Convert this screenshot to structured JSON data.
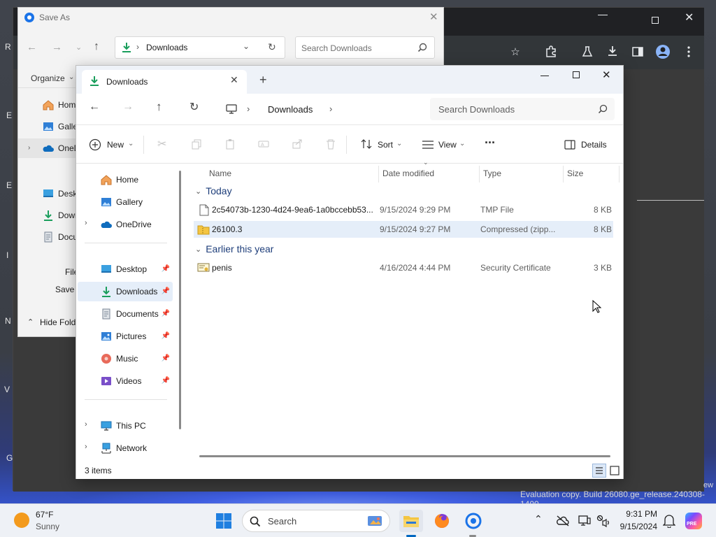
{
  "desktop": {
    "edge_letters": [
      "R",
      "E",
      "E",
      "I",
      "N",
      "V",
      "G"
    ],
    "watermark": "Evaluation copy. Build 26080.ge_release.240308-1400",
    "watermark_tail": "ew"
  },
  "chrome": {
    "icons": [
      "star-icon",
      "extensions-icon",
      "labs-icon",
      "download-icon",
      "sidebar-icon",
      "profile-icon",
      "more-icon"
    ]
  },
  "saveas": {
    "title": "Save As",
    "address": "Downloads",
    "search_placeholder": "Search Downloads",
    "organize": "Organize",
    "nav_items": [
      "Hom",
      "Galle",
      "OneD",
      "Deskt",
      "Dowr",
      "Docu"
    ],
    "file_label": "File",
    "save_label": "Save a",
    "hide_folders": "Hide Fold"
  },
  "explorer": {
    "tab_title": "Downloads",
    "breadcrumb": "Downloads",
    "search_placeholder": "Search Downloads",
    "toolbar": {
      "new": "New",
      "sort": "Sort",
      "view": "View",
      "more": "···",
      "details": "Details"
    },
    "nav": {
      "home": "Home",
      "gallery": "Gallery",
      "onedrive": "OneDrive",
      "desktop": "Desktop",
      "downloads": "Downloads",
      "documents": "Documents",
      "pictures": "Pictures",
      "music": "Music",
      "videos": "Videos",
      "this_pc": "This PC",
      "network": "Network"
    },
    "columns": {
      "name": "Name",
      "date": "Date modified",
      "type": "Type",
      "size": "Size"
    },
    "groups": {
      "today": "Today",
      "earlier": "Earlier this year"
    },
    "files": [
      {
        "name": "2c54073b-1230-4d24-9ea6-1a0bccebb53...",
        "date": "9/15/2024 9:29 PM",
        "type": "TMP File",
        "size": "8 KB",
        "icon": "file-icon"
      },
      {
        "name": "26100.3",
        "date": "9/15/2024 9:27 PM",
        "type": "Compressed (zipp...",
        "size": "8 KB",
        "icon": "zip-folder-icon"
      },
      {
        "name": "penis",
        "date": "4/16/2024 4:44 PM",
        "type": "Security Certificate",
        "size": "3 KB",
        "icon": "certificate-icon"
      }
    ],
    "status": "3 items"
  },
  "taskbar": {
    "weather_temp": "67°F",
    "weather_desc": "Sunny",
    "search": "Search",
    "time": "9:31 PM",
    "date": "9/15/2024",
    "pre_badge": "PRE"
  },
  "colors": {
    "accent": "#0067c0",
    "selection": "#e5eef9",
    "group_header": "#1e3e7a",
    "download_green": "#1a9e5c"
  }
}
